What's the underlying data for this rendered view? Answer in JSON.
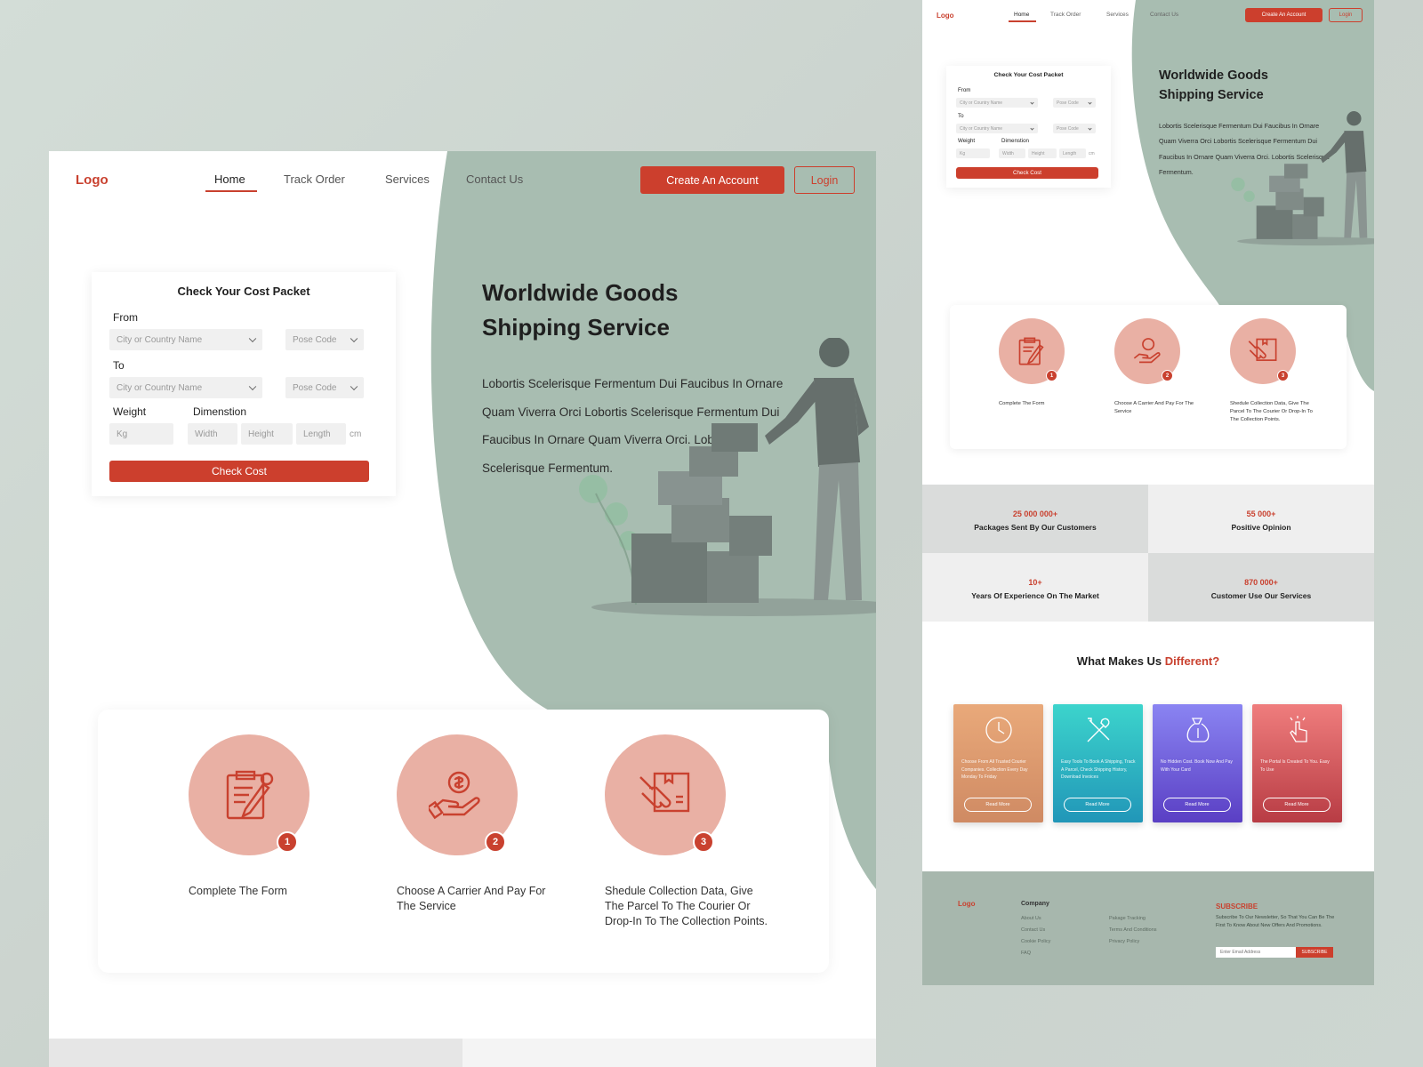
{
  "brand": {
    "logo": "Logo",
    "accent": "#c9412f",
    "wave_color": "#a8bdb1"
  },
  "nav": {
    "items": [
      "Home",
      "Track Order",
      "Services",
      "Contact Us"
    ],
    "active": "Home",
    "create_account": "Create An Account",
    "login": "Login"
  },
  "cost_form": {
    "title": "Check Your Cost Packet",
    "from_label": "From",
    "to_label": "To",
    "city_placeholder": "City or Country Name",
    "post_code_placeholder": "Pose Code",
    "weight_label": "Weight",
    "dimension_label": "Dimenstion",
    "weight_placeholder": "Kg",
    "width_placeholder": "Width",
    "height_placeholder": "Height",
    "length_placeholder": "Length",
    "unit": "cm",
    "submit": "Check Cost"
  },
  "hero": {
    "title": "Worldwide Goods Shipping Service",
    "description": "Lobortis Scelerisque Fermentum Dui Faucibus In Ornare Quam Viverra Orci Lobortis Scelerisque Fermentum Dui Faucibus In Ornare Quam Viverra Orci. Lobortis Scelerisque Fermentum."
  },
  "steps": [
    {
      "number": "1",
      "text": "Complete The Form",
      "icon": "clipboard-icon"
    },
    {
      "number": "2",
      "text": "Choose A Carrier And Pay For The Service",
      "icon": "hand-coin-icon"
    },
    {
      "number": "3",
      "text": "Shedule Collection Data, Give The Parcel To The Courier Or Drop-In To The Collection Points.",
      "icon": "parcel-hand-icon"
    }
  ],
  "stats": [
    {
      "value": "25 000 000+",
      "label": "Packages Sent By Our Customers"
    },
    {
      "value": "55 000+",
      "label": "Positive Opinion"
    },
    {
      "value": "10+",
      "label": "Years Of Experience On The Market"
    },
    {
      "value": "870 000+",
      "label": "Customer Use Our Services"
    }
  ],
  "different": {
    "title_prefix": "What Makes Us",
    "title_accent": "Different?",
    "cards": [
      {
        "text": "Choose From All Trusted Courier Companies. Collection Every Day Monday To Friday",
        "button": "Read More",
        "icon": "clock-24-icon",
        "color_top": "#e9a97a",
        "color_bottom": "#cf8a63"
      },
      {
        "text": "Easy Tools To Book A Shipping, Track A Parcel, Check Shipping History, Download Invoices",
        "button": "Read More",
        "icon": "tools-icon",
        "color_top": "#3cd4cc",
        "color_bottom": "#2196b8"
      },
      {
        "text": "No Hidden Cost. Book Now And Pay With Your Card",
        "button": "Read More",
        "icon": "money-bag-icon",
        "color_top": "#8a84f2",
        "color_bottom": "#5a3fc4"
      },
      {
        "text": "The Portal Is Created To You. Easy To Use",
        "button": "Read More",
        "icon": "pointer-hand-icon",
        "color_top": "#ef7d7d",
        "color_bottom": "#b83c44"
      }
    ]
  },
  "footer": {
    "logo": "Logo",
    "company_heading": "Company",
    "col1": [
      "About Us",
      "Contact Us",
      "Cookie Policy",
      "FAQ"
    ],
    "col2": [
      "Pakage Tracking",
      "Terms And Conditions",
      "Privacy Policy"
    ],
    "subscribe_title": "SUBSCRIBE",
    "subscribe_text": "Subscribe To Our Newsletter, So That You Can Be The First To Know About New Offers And Promotions.",
    "email_placeholder": "Enter Email Address",
    "subscribe_button": "SUBSCRIBE"
  }
}
